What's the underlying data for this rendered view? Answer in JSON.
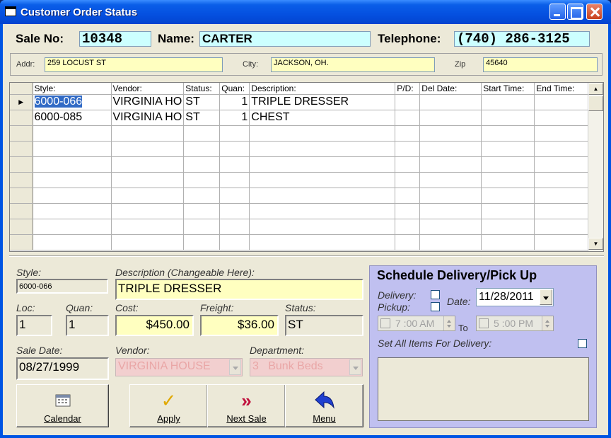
{
  "window": {
    "title": "Customer Order Status"
  },
  "header": {
    "sale_no_label": "Sale No:",
    "sale_no": "10348",
    "name_label": "Name:",
    "name": "CARTER",
    "telephone_label": "Telephone:",
    "telephone": "(740) 286-3125"
  },
  "address": {
    "addr_label": "Addr:",
    "addr": "259 LOCUST ST",
    "city_label": "City:",
    "city": "JACKSON, OH.",
    "zip_label": "Zip",
    "zip": "45640"
  },
  "grid": {
    "columns": [
      "Style:",
      "Vendor:",
      "Status:",
      "Quan:",
      "Description:",
      "P/D:",
      "Del Date:",
      "Start Time:",
      "End Time:"
    ],
    "rows": [
      {
        "style": "6000-066",
        "vendor": "VIRGINIA HO",
        "status": "ST",
        "quan": "1",
        "description": "TRIPLE DRESSER",
        "pd": "",
        "del_date": "",
        "start": "",
        "end": ""
      },
      {
        "style": "6000-085",
        "vendor": "VIRGINIA HO",
        "status": "ST",
        "quan": "1",
        "description": "CHEST",
        "pd": "",
        "del_date": "",
        "start": "",
        "end": ""
      }
    ]
  },
  "detail": {
    "style_label": "Style:",
    "style": "6000-066",
    "description_label": "Description (Changeable Here):",
    "description": "TRIPLE DRESSER",
    "loc_label": "Loc:",
    "loc": "1",
    "quan_label": "Quan:",
    "quan": "1",
    "cost_label": "Cost:",
    "cost": "$450.00",
    "freight_label": "Freight:",
    "freight": "$36.00",
    "status_label": "Status:",
    "status": "ST",
    "sale_date_label": "Sale Date:",
    "sale_date": "08/27/1999",
    "vendor_label": "Vendor:",
    "vendor": "VIRGINIA HOUSE",
    "department_label": "Department:",
    "department": "3   Bunk Beds"
  },
  "buttons": {
    "calendar": "Calendar",
    "apply": "Apply",
    "next_sale": "Next Sale",
    "menu": "Menu"
  },
  "schedule": {
    "title": "Schedule Delivery/Pick Up",
    "delivery_label": "Delivery:",
    "pickup_label": "Pickup:",
    "date_label": "Date:",
    "date": "11/28/2011",
    "start_time": "7 :00 AM",
    "to_label": "To",
    "end_time": "5 :00 PM",
    "set_all_label": "Set All Items For Delivery:"
  },
  "colors": {
    "title_bar": "#0054e3",
    "cyan_field": "#ccffff",
    "yellow_field": "#ffffc0",
    "schedule_bg": "#c0c0f0"
  }
}
